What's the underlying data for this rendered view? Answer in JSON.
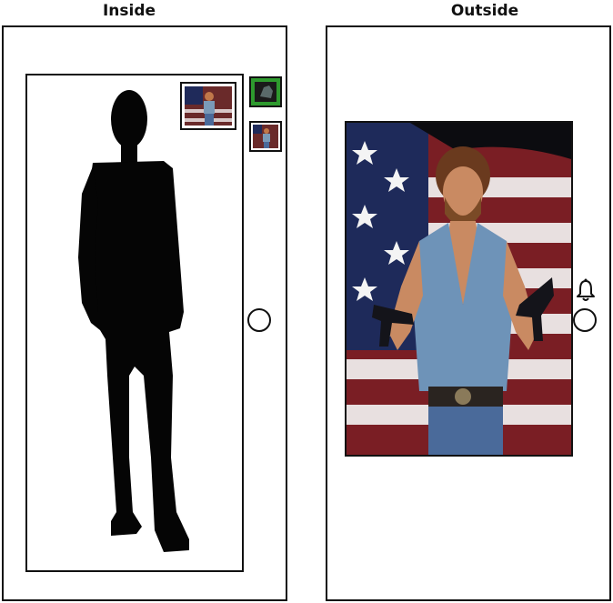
{
  "labels": {
    "inside": "Inside",
    "outside": "Outside"
  },
  "icons": {
    "bell": "bell-icon",
    "doorknob": "doorknob-icon"
  },
  "colors": {
    "outline": "#111111",
    "silhouette": "#050505",
    "camera_frame_green": "#2e9a2e"
  }
}
